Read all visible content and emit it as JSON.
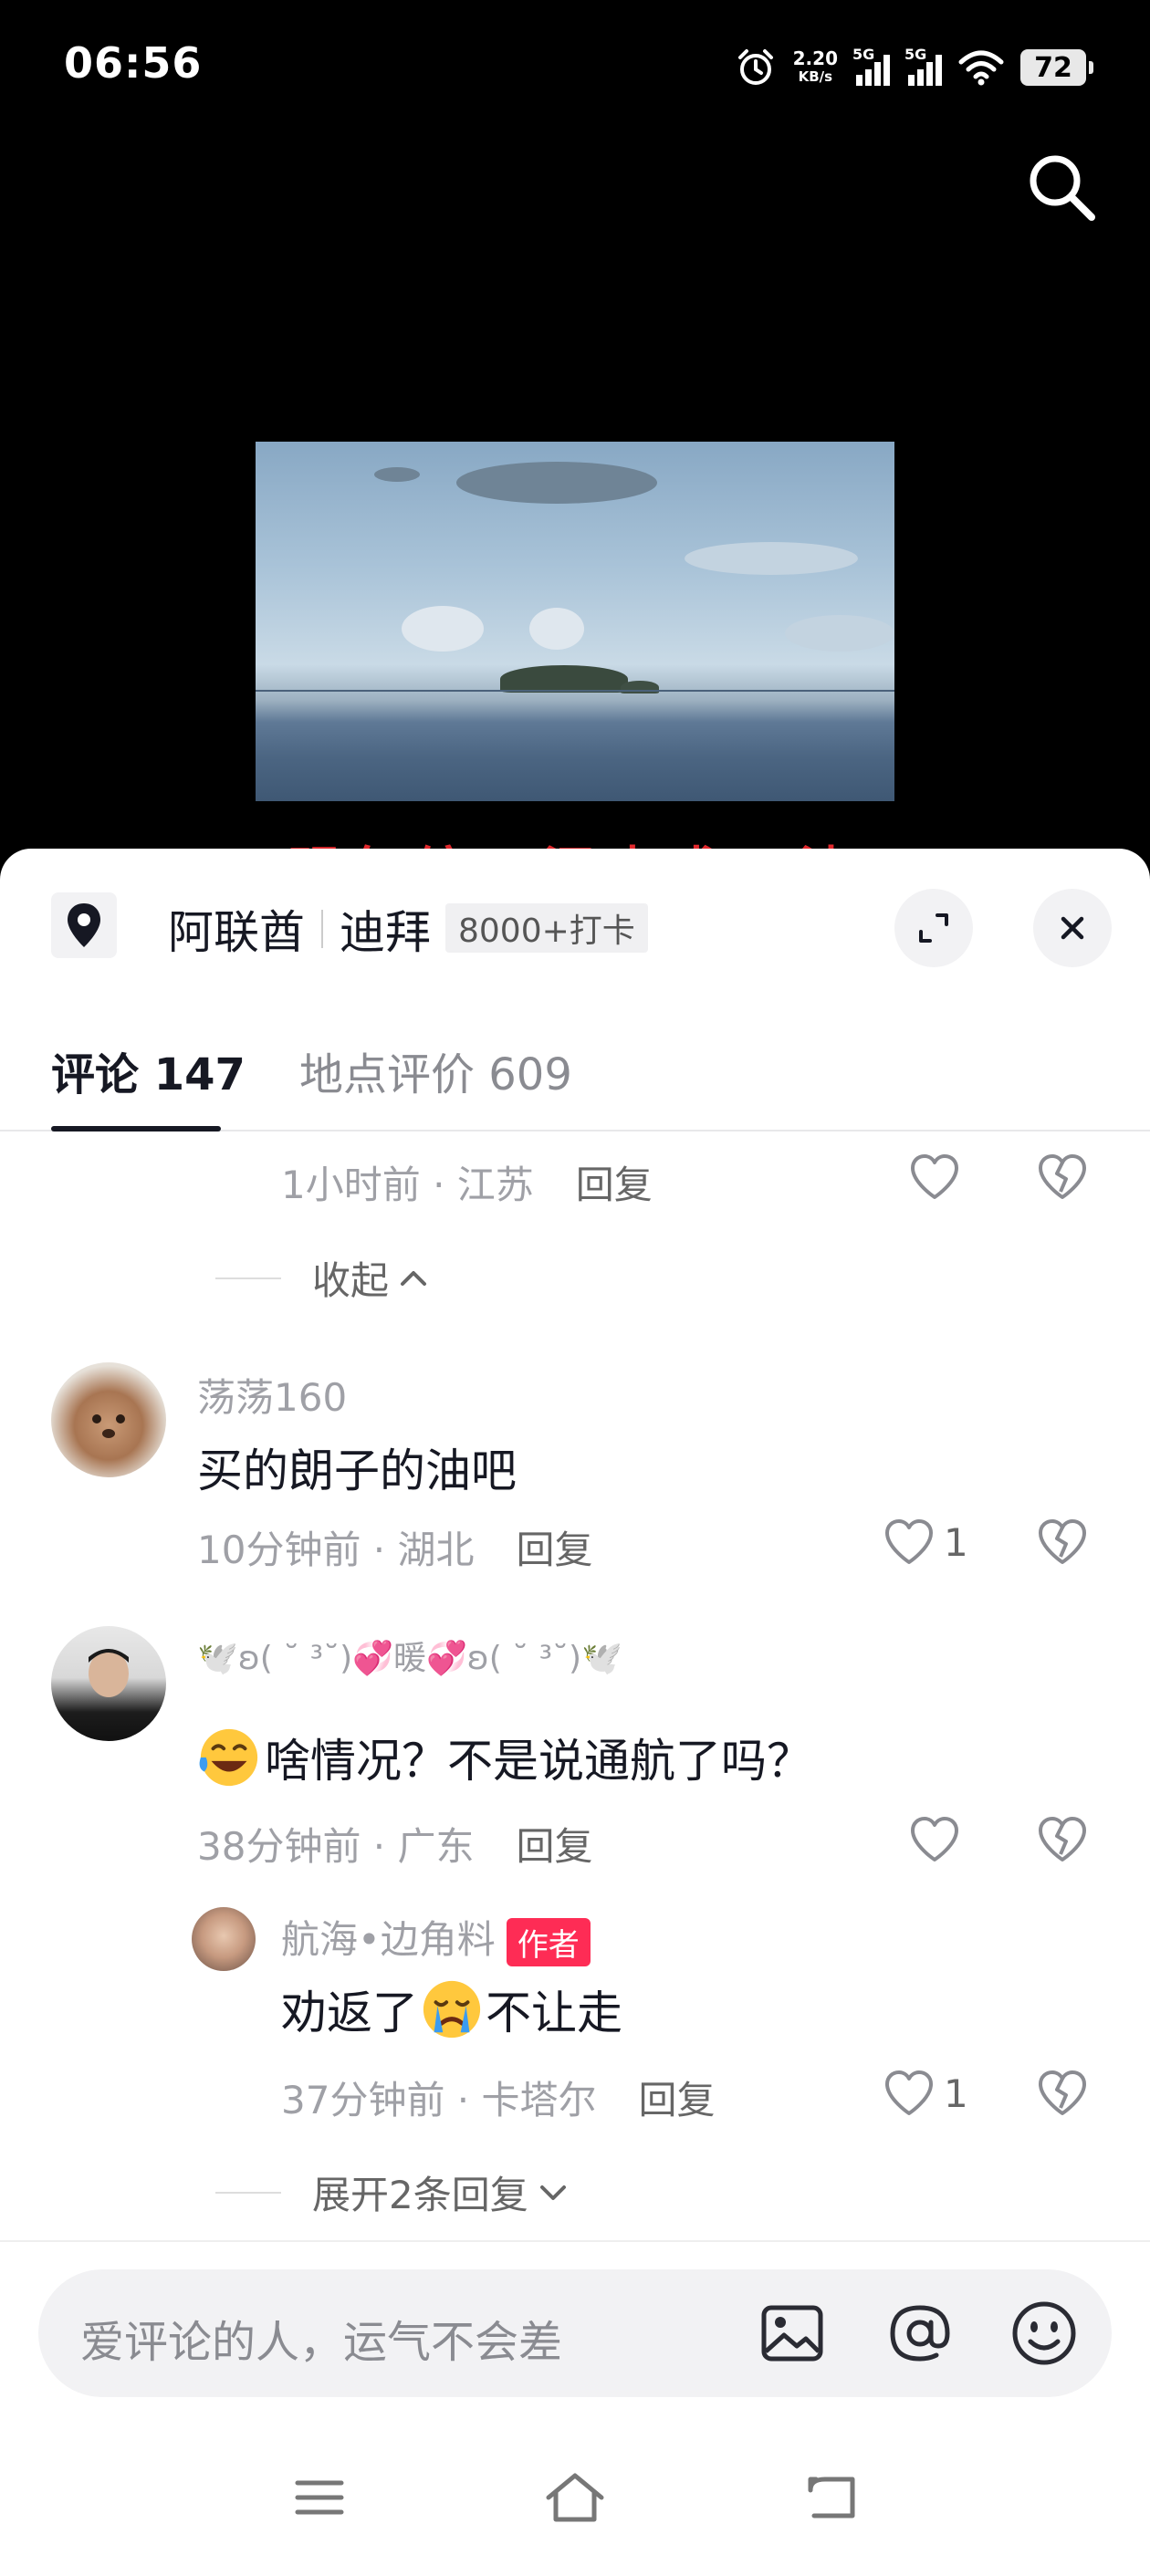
{
  "status_bar": {
    "time": "06:56",
    "net_speed_value": "2.20",
    "net_speed_unit": "KB/s",
    "sim1": "5G",
    "sim2": "5G",
    "battery": "72"
  },
  "video": {
    "caption_peek": "明年缤，泗声求，波"
  },
  "location": {
    "country": "阿联酋",
    "city": "迪拜",
    "checkins": "8000+打卡"
  },
  "tabs": [
    {
      "label": "评论 147",
      "active": true
    },
    {
      "label": "地点评价 609",
      "active": false
    }
  ],
  "comments": {
    "prev_tail": {
      "meta": "1小时前 · 江苏",
      "reply": "回复"
    },
    "collapse_label": "收起",
    "c1": {
      "username": "荡荡160",
      "text": "买的朗子的油吧",
      "meta": "10分钟前 · 湖北",
      "reply": "回复",
      "likes": "1"
    },
    "c2": {
      "username": "🕊️ʚ⁠(⁠ ⁠˘⁠ ⁠³⁠˘⁠)💞暖💞ʚ⁠(⁠ ⁠˘⁠ ⁠³⁠˘⁠)🕊️",
      "text": "啥情况？不是说通航了吗？",
      "meta": "38分钟前 · 广东",
      "reply": "回复",
      "sub": {
        "username": "航海•边角料",
        "badge": "作者",
        "text_before": "劝返了",
        "text_after": "不让走",
        "meta": "37分钟前 · 卡塔尔",
        "reply": "回复",
        "likes": "1"
      }
    },
    "expand_label": "展开2条回复"
  },
  "input": {
    "placeholder": "爱评论的人，运气不会差"
  },
  "colors": {
    "accent": "#fe2c55",
    "text_primary": "#161823",
    "text_secondary": "#9fa0a6"
  }
}
